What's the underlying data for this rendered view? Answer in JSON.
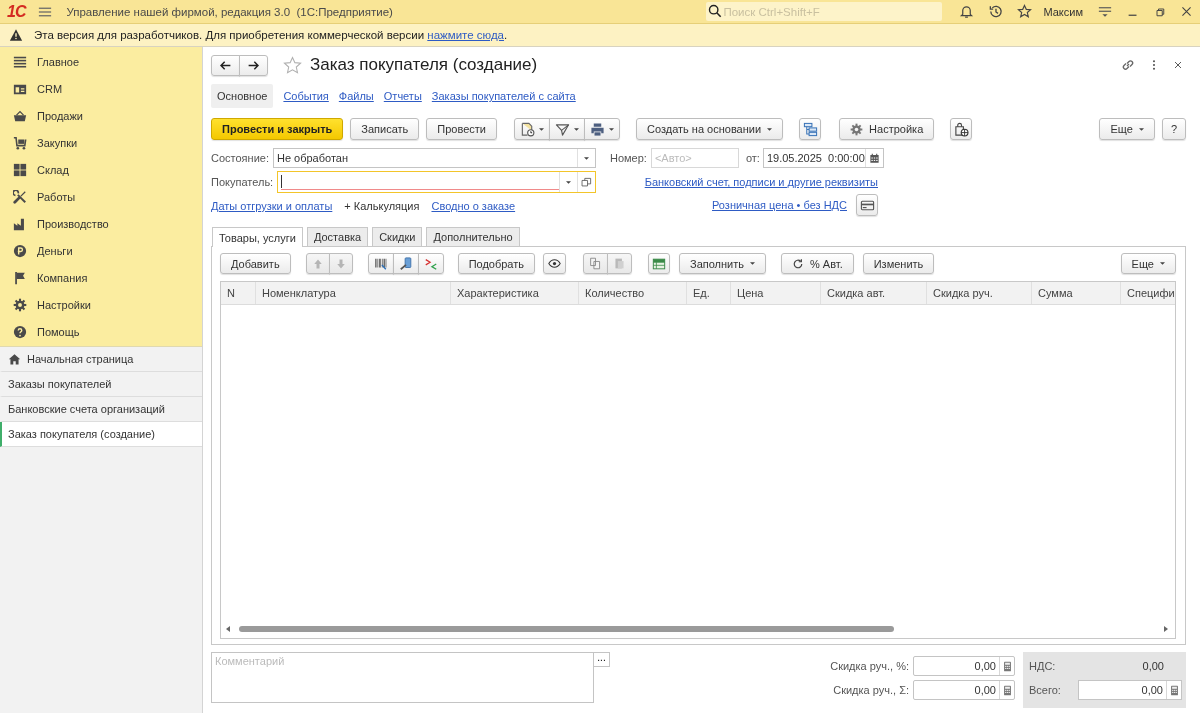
{
  "app_bar": {
    "logo": "1С",
    "title": "Управление нашей фирмой, редакция 3.0  (1С:Предприятие)",
    "search": {
      "placeholder": "Поиск Ctrl+Shift+F"
    },
    "user": "Максим"
  },
  "notice": {
    "text": "Эта версия для разработчиков. Для приобретения коммерческой версии ",
    "link": "нажмите сюда",
    "end": "."
  },
  "sidebar": {
    "sections": [
      {
        "label": "Главное"
      },
      {
        "label": "CRM"
      },
      {
        "label": "Продажи"
      },
      {
        "label": "Закупки"
      },
      {
        "label": "Склад"
      },
      {
        "label": "Работы"
      },
      {
        "label": "Производство"
      },
      {
        "label": "Деньги"
      },
      {
        "label": "Компания"
      },
      {
        "label": "Настройки"
      },
      {
        "label": "Помощь"
      }
    ],
    "open_windows": [
      {
        "label": "Начальная страница",
        "kind": "home",
        "selected": false
      },
      {
        "label": "Заказы покупателей",
        "kind": "window",
        "selected": false
      },
      {
        "label": "Банковские счета организаций",
        "kind": "window",
        "selected": false
      },
      {
        "label": "Заказ покупателя (создание)",
        "kind": "window",
        "selected": true
      }
    ]
  },
  "form": {
    "title": "Заказ покупателя (создание)",
    "starred": false,
    "nav_tabs": [
      {
        "label": "Основное",
        "selected": true
      },
      {
        "label": "События",
        "selected": false
      },
      {
        "label": "Файлы",
        "selected": false
      },
      {
        "label": "Отчеты",
        "selected": false
      },
      {
        "label": "Заказы покупателей с сайта",
        "selected": false
      }
    ],
    "commands": {
      "post_and_close": "Провести и закрыть",
      "save": "Записать",
      "post": "Провести",
      "create_based_on": "Создать на основании",
      "settings": "Настройка",
      "more": "Еще",
      "help": "?"
    },
    "fields": {
      "status": {
        "label": "Состояние:",
        "value": "Не обработан"
      },
      "number": {
        "label": "Номер:",
        "placeholder": "<Авто>"
      },
      "date": {
        "label": "от:",
        "value": "19.05.2025  0:00:00"
      },
      "customer": {
        "label": "Покупатель:",
        "focused": true,
        "required": true
      }
    },
    "links": {
      "requisites": "Банковский счет, подписи и другие реквизиты",
      "dates": "Даты отгрузки и оплаты",
      "costing": "+ Калькуляция",
      "summary": "Сводно о заказе",
      "price": "Розничная цена • без НДС"
    },
    "table_tabs": [
      {
        "label": "Товары, услуги",
        "selected": true
      },
      {
        "label": "Доставка",
        "selected": false
      },
      {
        "label": "Скидки",
        "selected": false
      },
      {
        "label": "Дополнительно",
        "selected": false
      }
    ],
    "table_toolbar": {
      "add": "Добавить",
      "pick": "Подобрать",
      "fill": "Заполнить",
      "auto_discount": "% Авт.",
      "change": "Изменить",
      "more": "Еще"
    },
    "table": {
      "columns": [
        "N",
        "Номенклатура",
        "Характеристика",
        "Количество",
        "Ед.",
        "Цена",
        "Скидка авт.",
        "Скидка руч.",
        "Сумма",
        "Специфи"
      ]
    },
    "comment": {
      "placeholder": "Комментарий",
      "button": "..."
    },
    "totals": {
      "discount_percent": {
        "label": "Скидка руч., %:",
        "value": "0,00"
      },
      "discount_sum": {
        "label": "Скидка руч., Σ:",
        "value": "0,00"
      },
      "vat": {
        "label": "НДС:",
        "value": "0,00"
      },
      "total": {
        "label": "Всего:",
        "value": "0,00"
      }
    }
  }
}
